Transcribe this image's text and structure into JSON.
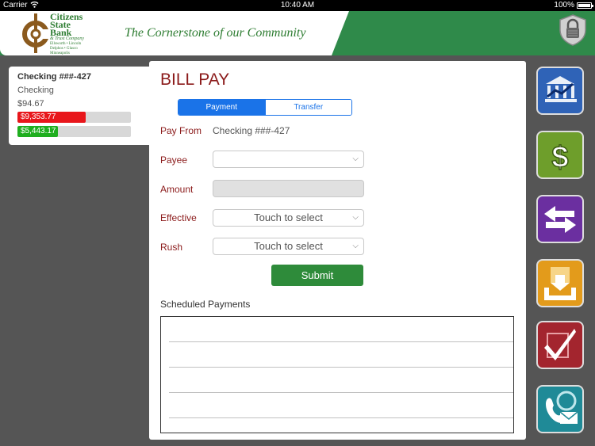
{
  "status_bar": {
    "carrier": "Carrier",
    "time": "10:40 AM",
    "battery": "100%"
  },
  "header": {
    "bank_name_line1": "Citizens",
    "bank_name_line2": "State",
    "bank_name_line3": "Bank",
    "bank_sub": "& Trust Company",
    "bank_towns": "Ellsworth • Lincoln",
    "bank_towns2": "Delphos • Glasco",
    "bank_towns3": "Minneapolis",
    "tagline": "The Cornerstone of our Community"
  },
  "account": {
    "name": "Checking ###-427",
    "type": "Checking",
    "balance": "$94.67",
    "bar1_label": "$9,353.77",
    "bar1_fill": 0.6,
    "bar1_color": "#e8161b",
    "bar2_label": "$5,443.17",
    "bar2_fill": 0.36,
    "bar2_color": "#1fae1f"
  },
  "bill_pay": {
    "title": "BILL PAY",
    "tabs": {
      "payment": "Payment",
      "transfer": "Transfer"
    },
    "pay_from_label": "Pay From",
    "pay_from_value": "Checking ###-427",
    "payee_label": "Payee",
    "payee_value": "",
    "amount_label": "Amount",
    "amount_value": "",
    "effective_label": "Effective",
    "effective_value": "Touch to select",
    "rush_label": "Rush",
    "rush_value": "Touch to select",
    "submit": "Submit",
    "scheduled_label": "Scheduled Payments"
  },
  "nav": [
    {
      "icon": "bank-chart-icon",
      "color": "#2f63b7"
    },
    {
      "icon": "dollar-icon",
      "color": "#6e9e2b"
    },
    {
      "icon": "transfer-arrows-icon",
      "color": "#6b2fa0"
    },
    {
      "icon": "deposit-tray-icon",
      "color": "#e39b1b"
    },
    {
      "icon": "checkmark-icon",
      "color": "#a3252e"
    },
    {
      "icon": "contact-icon",
      "color": "#1f8a97"
    }
  ]
}
